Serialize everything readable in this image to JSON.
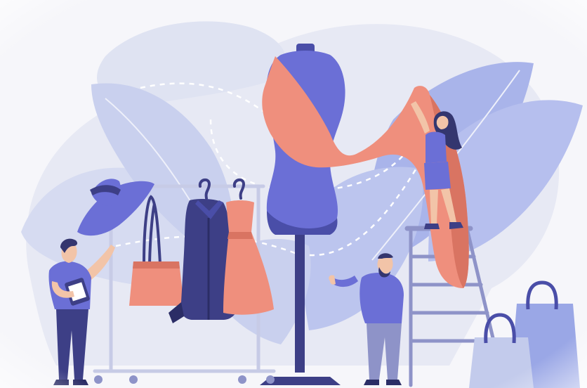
{
  "illustration": {
    "subject": "fashion-design-studio",
    "palette": {
      "background": "#f6f6fa",
      "leaf_light": "#dfe3f2",
      "leaf_mid": "#c3cbec",
      "leaf_blue": "#9aa7e6",
      "purple": "#6b6fd6",
      "purple_dark": "#4a4ea8",
      "navy": "#3d3f86",
      "coral": "#ef8f7d",
      "coral_dark": "#d97462",
      "skin": "#f2c4a8",
      "hair": "#34366f",
      "rack": "#c7cbe6",
      "rack_dark": "#8e93c8",
      "white": "#ffffff"
    },
    "icons": [
      "leaf-icon",
      "mannequin-icon",
      "hat-icon",
      "handbag-icon",
      "hanger-icon",
      "coat-icon",
      "dress-icon",
      "clipboard-icon",
      "ladder-icon",
      "shopping-bag-icon",
      "fabric-icon"
    ]
  }
}
